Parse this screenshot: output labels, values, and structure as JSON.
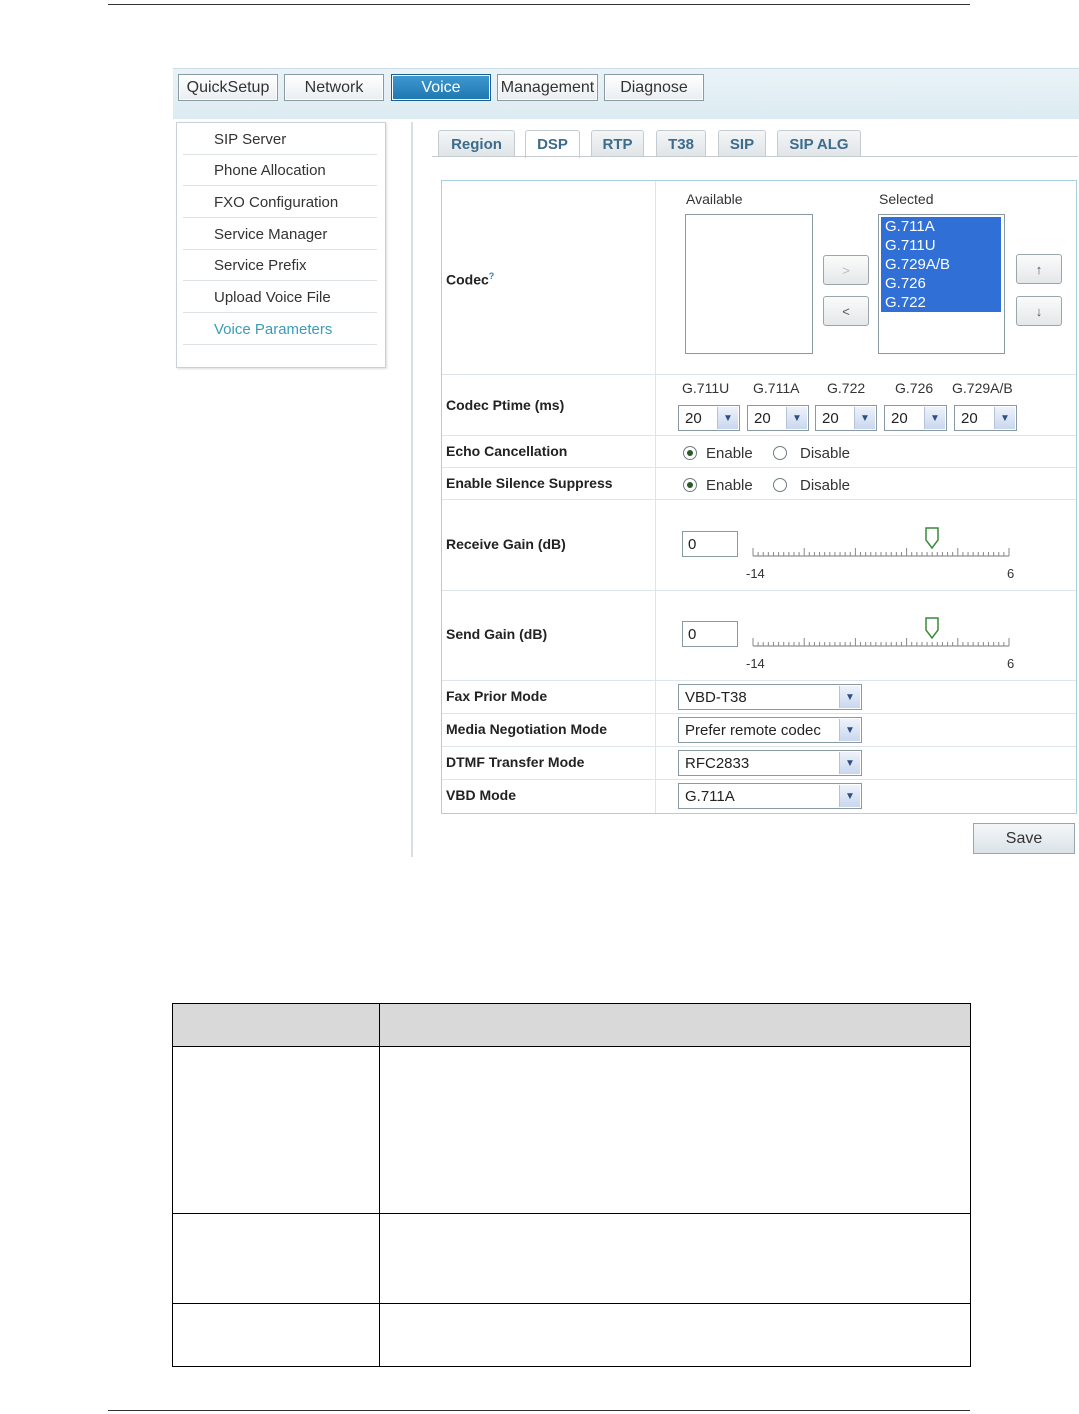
{
  "topbar": {
    "buttons": [
      "QuickSetup",
      "Network",
      "Voice",
      "Management",
      "Diagnose"
    ],
    "active": "Voice"
  },
  "sidebar": {
    "items": [
      "SIP Server",
      "Phone Allocation",
      "FXO Configuration",
      "Service Manager",
      "Service Prefix",
      "Upload Voice File",
      "Voice Parameters"
    ],
    "active": "Voice Parameters"
  },
  "tabs": {
    "items": [
      "Region",
      "DSP",
      "RTP",
      "T38",
      "SIP",
      "SIP ALG"
    ],
    "active": "DSP"
  },
  "form": {
    "codec": {
      "label": "Codec",
      "help_mark": "?",
      "available_label": "Available",
      "selected_label": "Selected",
      "available": [],
      "selected": [
        "G.711A",
        "G.711U",
        "G.729A/B",
        "G.726",
        "G.722"
      ],
      "add_btn": ">",
      "remove_btn": "<",
      "up_btn": "↑",
      "down_btn": "↓"
    },
    "ptime": {
      "label": "Codec Ptime  (ms)",
      "codecs": [
        "G.711U",
        "G.711A",
        "G.722",
        "G.726",
        "G.729A/B"
      ],
      "values": [
        "20",
        "20",
        "20",
        "20",
        "20"
      ]
    },
    "echo": {
      "label": "Echo Cancellation",
      "enable": "Enable",
      "disable": "Disable",
      "value": "Enable"
    },
    "silence": {
      "label": "Enable Silence Suppress",
      "enable": "Enable",
      "disable": "Disable",
      "value": "Enable"
    },
    "receive_gain": {
      "label": "Receive Gain  (dB)",
      "value": "0",
      "min": "-14",
      "max": "6"
    },
    "send_gain": {
      "label": "Send Gain  (dB)",
      "value": "0",
      "min": "-14",
      "max": "6"
    },
    "fax": {
      "label": "Fax Prior Mode",
      "value": "VBD-T38"
    },
    "media": {
      "label": "Media Negotiation Mode",
      "value": "Prefer remote codec"
    },
    "dtmf": {
      "label": "DTMF Transfer Mode",
      "value": "RFC2833"
    },
    "vbd": {
      "label": "VBD Mode",
      "value": "G.711A"
    },
    "save": "Save"
  },
  "colors": {
    "accent": "#1f76b0",
    "selected_option": "#2f6fd6",
    "active_side": "#3a9cb7"
  }
}
